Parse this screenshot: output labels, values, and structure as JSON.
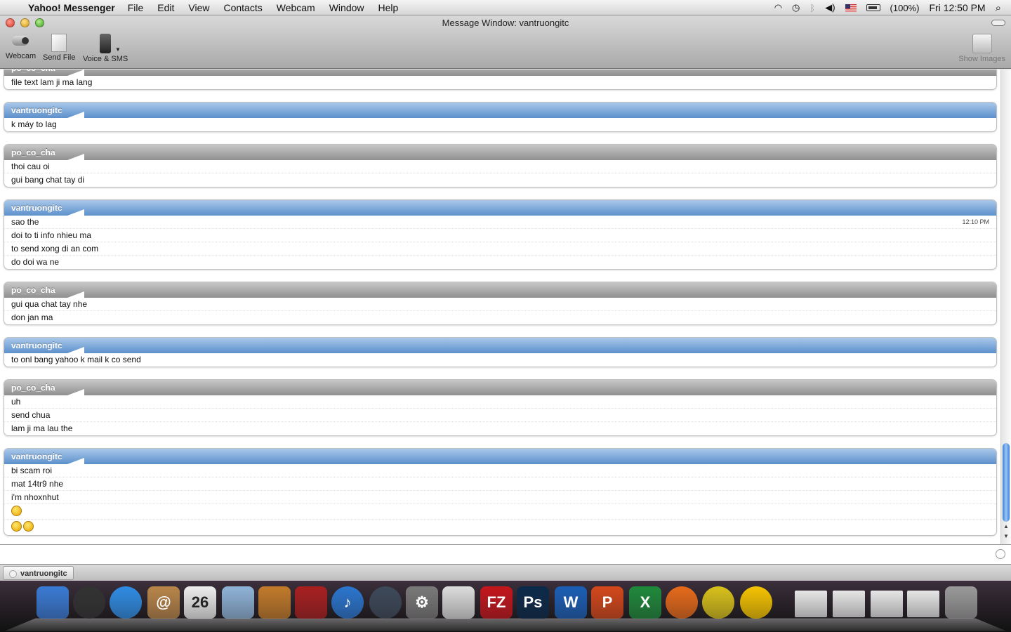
{
  "menubar": {
    "app_name": "Yahoo! Messenger",
    "items": [
      "File",
      "Edit",
      "View",
      "Contacts",
      "Webcam",
      "Window",
      "Help"
    ],
    "battery": "(100%)",
    "clock": "Fri 12:50 PM"
  },
  "window": {
    "title": "Message Window: vantruongitc",
    "toolbar": {
      "webcam": "Webcam",
      "send_file": "Send File",
      "voice_sms": "Voice & SMS",
      "show_images": "Show Images"
    }
  },
  "messages": [
    {
      "sender": "po_co_cha",
      "style": "gray",
      "lines": [
        "file text lam ji ma lang"
      ]
    },
    {
      "sender": "vantruongitc",
      "style": "blue",
      "lines": [
        "k máy to lag"
      ]
    },
    {
      "sender": "po_co_cha",
      "style": "gray",
      "lines": [
        "thoi cau oi",
        "gui bang chat tay di"
      ]
    },
    {
      "sender": "vantruongitc",
      "style": "blue",
      "timestamp": "12:10 PM",
      "lines": [
        "sao the",
        "doi to ti info nhieu ma",
        "to send xong di an com",
        "do doi wa ne"
      ]
    },
    {
      "sender": "po_co_cha",
      "style": "gray",
      "lines": [
        "gui qua chat tay nhe",
        "don jan ma"
      ]
    },
    {
      "sender": "vantruongitc",
      "style": "blue",
      "lines": [
        "to onl bang yahoo k mail k co send"
      ]
    },
    {
      "sender": "po_co_cha",
      "style": "gray",
      "lines": [
        "uh",
        "send chua",
        "lam ji ma lau the"
      ]
    },
    {
      "sender": "vantruongitc",
      "style": "blue",
      "lines": [
        "bi scam roi",
        "mat 14tr9 nhe",
        "i'm nhoxnhut"
      ],
      "emoticons": [
        "laughing-emoticon",
        "emoticon-pair"
      ]
    }
  ],
  "tabs": [
    {
      "label": "vantruongitc"
    }
  ],
  "dock": [
    {
      "name": "finder",
      "color": "#3a7bd5",
      "glyph": ""
    },
    {
      "name": "dashboard",
      "color": "#333333",
      "glyph": ""
    },
    {
      "name": "safari",
      "color": "#2f8de4",
      "glyph": ""
    },
    {
      "name": "address-book",
      "color": "#b8864a",
      "glyph": "@"
    },
    {
      "name": "ical",
      "color": "#eeeeee",
      "glyph": "26"
    },
    {
      "name": "preview",
      "color": "#8fb4d8",
      "glyph": ""
    },
    {
      "name": "iphoto",
      "color": "#c27b2a",
      "glyph": ""
    },
    {
      "name": "photo-booth",
      "color": "#a81f1f",
      "glyph": ""
    },
    {
      "name": "itunes",
      "color": "#2a76cf",
      "glyph": "♪"
    },
    {
      "name": "time-machine",
      "color": "#3d4a5a",
      "glyph": ""
    },
    {
      "name": "system-preferences",
      "color": "#7a7a7a",
      "glyph": "⚙"
    },
    {
      "name": "textedit",
      "color": "#dddddd",
      "glyph": ""
    },
    {
      "name": "filezilla",
      "color": "#c4161c",
      "glyph": "FZ"
    },
    {
      "name": "photoshop",
      "color": "#0b2a4a",
      "glyph": "Ps"
    },
    {
      "name": "word",
      "color": "#1b5fb5",
      "glyph": "W"
    },
    {
      "name": "powerpoint",
      "color": "#d4481b",
      "glyph": "P"
    },
    {
      "name": "excel",
      "color": "#1f8a3b",
      "glyph": "X"
    },
    {
      "name": "firefox",
      "color": "#e66a1a",
      "glyph": ""
    },
    {
      "name": "chrome",
      "color": "#d8c21a",
      "glyph": ""
    },
    {
      "name": "yahoo-messenger",
      "color": "#f5c400",
      "glyph": ""
    },
    {
      "name": "window-firefox",
      "color": "#e6e6e6",
      "glyph": ""
    },
    {
      "name": "window-chrome",
      "color": "#e6e6e6",
      "glyph": ""
    },
    {
      "name": "window-messenger-1",
      "color": "#e6e6e6",
      "glyph": ""
    },
    {
      "name": "window-messenger-2",
      "color": "#e6e6e6",
      "glyph": ""
    },
    {
      "name": "trash",
      "color": "#9a9a9a",
      "glyph": ""
    }
  ]
}
